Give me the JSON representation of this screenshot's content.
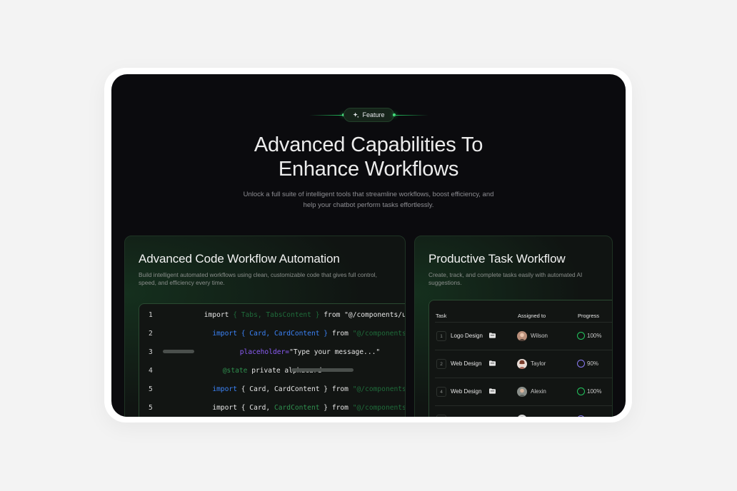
{
  "badge": {
    "label": "Feature",
    "icon": "sparkle-icon"
  },
  "hero": {
    "title_line1": "Advanced Capabilities To",
    "title_line2": "Enhance Workflows",
    "subtitle_line1": "Unlock a full suite of intelligent tools that streamline workflows, boost efficiency, and",
    "subtitle_line2": "help your chatbot perform tasks effortlessly."
  },
  "code_card": {
    "title": "Advanced Code Workflow Automation",
    "desc": "Build intelligent automated workflows using clean, customizable code that gives full control, speed, and efficiency every time.",
    "lines": [
      {
        "n": "1",
        "parts": [
          {
            "t": "import ",
            "c": "plain"
          },
          {
            "t": "{ Tabs, TabsContent }",
            "c": "dim"
          },
          {
            "t": " from \"@/components/ui/tabs,",
            "c": "plain"
          }
        ]
      },
      {
        "n": "2",
        "parts": [
          {
            "t": "  import { Card, CardContent }",
            "c": "blue"
          },
          {
            "t": " from ",
            "c": "plain"
          },
          {
            "t": "\"@/components,",
            "c": "dim"
          }
        ]
      },
      {
        "n": "3",
        "parts": [
          {
            "t": "placeholder=",
            "c": "purple"
          },
          {
            "t": "\"Type your message...\"",
            "c": "plain"
          }
        ]
      },
      {
        "n": "4",
        "parts": [
          {
            "t": "@state",
            "c": "green"
          },
          {
            "t": " private alphacard",
            "c": "plain"
          }
        ]
      },
      {
        "n": "5",
        "parts": [
          {
            "t": "  import",
            "c": "blue"
          },
          {
            "t": " { Card, CardContent } ",
            "c": "plain"
          },
          {
            "t": "from ",
            "c": "plain"
          },
          {
            "t": "\"@/components,",
            "c": "dim"
          }
        ]
      },
      {
        "n": "5",
        "parts": [
          {
            "t": "  import { Card, ",
            "c": "plain"
          },
          {
            "t": "CardContent",
            "c": "green"
          },
          {
            "t": " } from ",
            "c": "plain"
          },
          {
            "t": "\"@/components,",
            "c": "dim"
          }
        ]
      }
    ]
  },
  "task_card": {
    "title": "Productive Task Workflow",
    "desc": "Create, track, and complete tasks easily with automated AI suggestions.",
    "headers": {
      "task": "Task",
      "assigned": "Assigned to",
      "progress": "Progress"
    },
    "rows": [
      {
        "num": "1",
        "name": "Logo Design",
        "assignee": "Wilson",
        "progress": "100%",
        "progress_value": 100,
        "ring_color": "#22c55e"
      },
      {
        "num": "2",
        "name": "Web Design",
        "assignee": "Taylor",
        "progress": "90%",
        "progress_value": 90,
        "ring_color": "#8b7cf6"
      },
      {
        "num": "4",
        "name": "Web Design",
        "assignee": "Alexin",
        "progress": "100%",
        "progress_value": 100,
        "ring_color": "#22c55e"
      }
    ]
  },
  "colors": {
    "accent": "#22c55e",
    "background": "#0b0b0e",
    "frame": "#ffffff"
  }
}
